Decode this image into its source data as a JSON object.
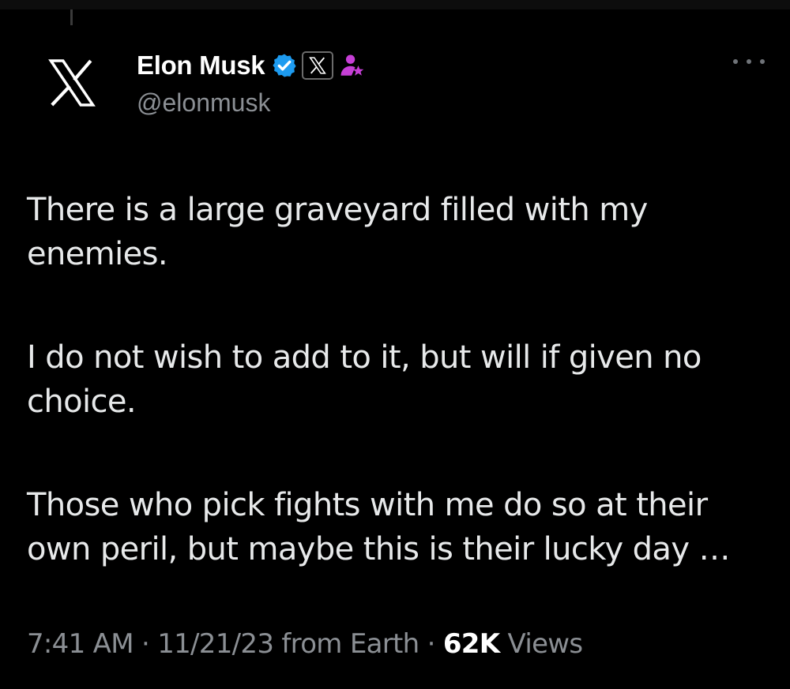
{
  "author": {
    "display_name": "Elon Musk",
    "handle": "@elonmusk",
    "avatar_icon": "x-logo-icon",
    "badges": [
      "verified-badge-icon",
      "x-affiliate-icon",
      "government-affiliation-icon"
    ]
  },
  "menu": {
    "more_icon": "more-options-icon"
  },
  "tweet": {
    "paragraphs": [
      "There is a large graveyard filled with my enemies.",
      "I do not wish to add to it, but will if given no choice.",
      "Those who pick fights with me do so at their own peril, but maybe this is their lucky day …"
    ]
  },
  "meta": {
    "time": "7:41 AM",
    "separator": " · ",
    "date": "11/21/23",
    "source": " from Earth",
    "views_count": "62K",
    "views_label": " Views"
  },
  "colors": {
    "background": "#000000",
    "text": "#e7e9ea",
    "muted": "#8b8f94",
    "verified_blue": "#1d9bf0",
    "gov_purple": "#c63fd6"
  }
}
